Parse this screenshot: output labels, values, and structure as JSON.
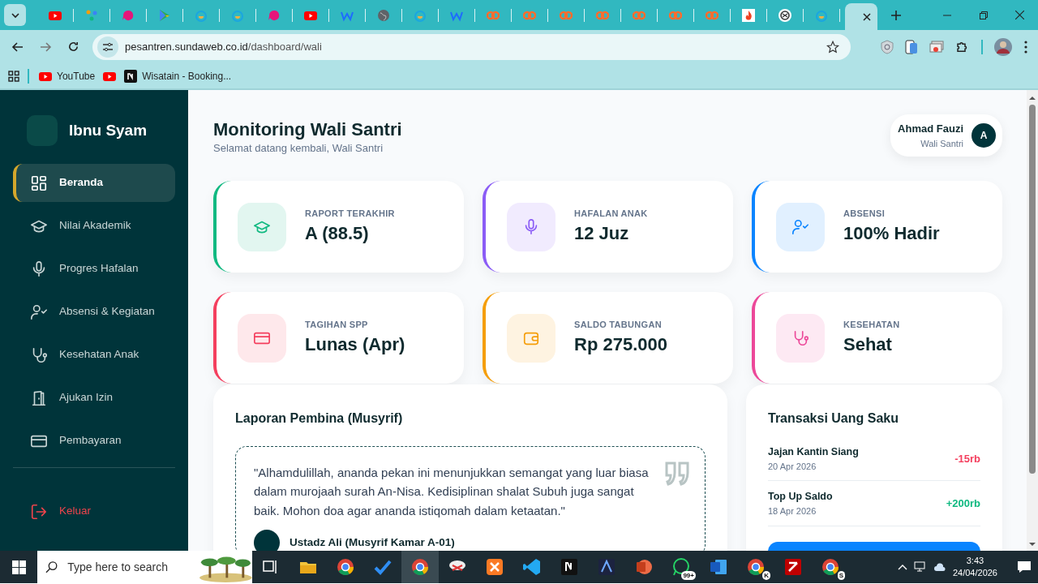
{
  "browser": {
    "tabs": [
      {
        "kind": "youtube",
        "selected": false
      },
      {
        "kind": "network",
        "selected": false
      },
      {
        "kind": "pink",
        "selected": false
      },
      {
        "kind": "play",
        "selected": false
      },
      {
        "kind": "smile",
        "selected": false
      },
      {
        "kind": "smile",
        "selected": false
      },
      {
        "kind": "pink",
        "selected": false
      },
      {
        "kind": "youtube",
        "selected": false
      },
      {
        "kind": "wave",
        "selected": false
      },
      {
        "kind": "globe",
        "selected": false
      },
      {
        "kind": "smile",
        "selected": false
      },
      {
        "kind": "wave",
        "selected": false
      },
      {
        "kind": "cpanel",
        "selected": false
      },
      {
        "kind": "cpanel",
        "selected": false
      },
      {
        "kind": "cpanel",
        "selected": false
      },
      {
        "kind": "cpanel",
        "selected": false
      },
      {
        "kind": "cpanel",
        "selected": false
      },
      {
        "kind": "cpanel",
        "selected": false
      },
      {
        "kind": "cpanel",
        "selected": false
      },
      {
        "kind": "fire",
        "selected": false
      },
      {
        "kind": "knot",
        "selected": false
      },
      {
        "kind": "smile",
        "selected": false
      },
      {
        "kind": "blank",
        "selected": true
      }
    ],
    "address": {
      "host": "pesantren.sundaweb.co.id",
      "path": "/dashboard/wali"
    },
    "bookmarks": [
      {
        "kind": "youtube",
        "label": "YouTube"
      },
      {
        "kind": "youtube"
      },
      {
        "kind": "notion",
        "label": "Wisatain - Booking..."
      }
    ]
  },
  "sidebar": {
    "brand": "Ibnu Syam",
    "items": [
      {
        "label": "Beranda",
        "kind": "grid",
        "selected": true
      },
      {
        "label": "Nilai Akademik",
        "kind": "cap",
        "selected": false
      },
      {
        "label": "Progres Hafalan",
        "kind": "mic",
        "selected": false
      },
      {
        "label": "Absensi & Kegiatan",
        "kind": "usercheck",
        "selected": false
      },
      {
        "label": "Kesehatan Anak",
        "kind": "steth",
        "selected": false
      },
      {
        "label": "Ajukan Izin",
        "kind": "door",
        "selected": false
      },
      {
        "label": "Pembayaran",
        "kind": "card",
        "selected": false
      }
    ],
    "logout": "Keluar"
  },
  "header": {
    "title": "Monitoring Wali Santri",
    "subtitle": "Selamat datang kembali, Wali Santri",
    "user": {
      "name": "Ahmad Fauzi",
      "role": "Wali Santri",
      "initial": "A"
    }
  },
  "stats": [
    {
      "label": "RAPORT TERAKHIR",
      "value": "A (88.5)",
      "kind": "cap",
      "color": "#10b981"
    },
    {
      "label": "HAFALAN ANAK",
      "value": "12 Juz",
      "kind": "mic",
      "color": "#8b5cf6"
    },
    {
      "label": "ABSENSI",
      "value": "100% Hadir",
      "kind": "usercheck",
      "color": "#0a84ff"
    },
    {
      "label": "TAGIHAN SPP",
      "value": "Lunas (Apr)",
      "kind": "card",
      "color": "#f43f5e"
    },
    {
      "label": "SALDO TABUNGAN",
      "value": "Rp 275.000",
      "kind": "wallet",
      "color": "#f59e0b"
    },
    {
      "label": "KESEHATAN",
      "value": "Sehat",
      "kind": "steth",
      "color": "#ec4899"
    }
  ],
  "report": {
    "title": "Laporan Pembina (Musyrif)",
    "quote": "\"Alhamdulillah, ananda pekan ini menunjukkan semangat yang luar biasa dalam murojaah surah An-Nisa. Kedisiplinan shalat Subuh juga sangat baik. Mohon doa agar ananda istiqomah dalam ketaatan.\"",
    "author": "Ustadz Ali (Musyrif Kamar A-01)"
  },
  "transactions": {
    "title": "Transaksi Uang Saku",
    "items": [
      {
        "name": "Jajan Kantin Siang",
        "date": "20 Apr 2026",
        "amount": "-15rb",
        "kind": "debit"
      },
      {
        "name": "Top Up Saldo",
        "date": "18 Apr 2026",
        "amount": "+200rb",
        "kind": "credit"
      }
    ]
  },
  "taskbar": {
    "search_placeholder": "Type here to search",
    "apps": [
      {
        "kind": "taskview",
        "selected": false
      },
      {
        "kind": "folder",
        "selected": false
      },
      {
        "kind": "browser",
        "selected": false
      },
      {
        "kind": "check",
        "selected": false
      },
      {
        "kind": "browser",
        "selected": true
      },
      {
        "kind": "snip",
        "selected": false
      },
      {
        "kind": "xampp",
        "selected": false
      },
      {
        "kind": "code",
        "selected": false
      },
      {
        "kind": "notion",
        "selected": false
      },
      {
        "kind": "vector",
        "selected": false
      },
      {
        "kind": "slides",
        "selected": false
      },
      {
        "kind": "chat",
        "badge": "99+",
        "selected": false
      },
      {
        "kind": "doc",
        "selected": false
      },
      {
        "kind": "browser",
        "badge": "K",
        "selected": false
      },
      {
        "kind": "ftp",
        "selected": false
      },
      {
        "kind": "browser",
        "badge": "S",
        "selected": false
      }
    ],
    "time": "3:43",
    "date": "24/04/2026"
  }
}
